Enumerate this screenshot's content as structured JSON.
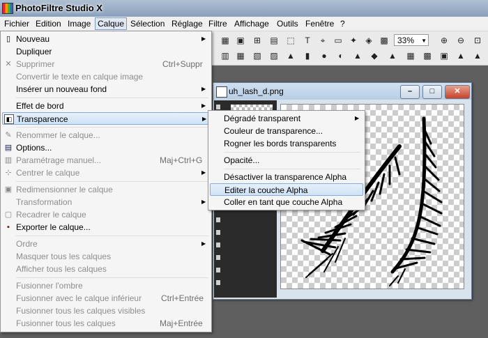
{
  "window": {
    "title": "PhotoFiltre Studio X"
  },
  "menubar": [
    "Fichier",
    "Edition",
    "Image",
    "Calque",
    "Sélection",
    "Réglage",
    "Filtre",
    "Affichage",
    "Outils",
    "Fenêtre",
    "?"
  ],
  "active_menu": "Calque",
  "toolbar": {
    "zoom": "33%"
  },
  "document": {
    "title": "uh_lash_d.png"
  },
  "calque_menu": {
    "items": [
      {
        "label": "Nouveau",
        "icon": "new-page-icon",
        "submenu": true
      },
      {
        "label": "Dupliquer"
      },
      {
        "label": "Supprimer",
        "icon": "delete-x-icon",
        "shortcut": "Ctrl+Suppr",
        "disabled": true
      },
      {
        "label": "Convertir le texte en calque image",
        "disabled": true
      },
      {
        "label": "Insérer un nouveau fond",
        "submenu": true
      },
      {
        "label": "Effet de bord",
        "submenu": true
      },
      {
        "label": "Transparence",
        "icon": "transparency-icon",
        "submenu": true,
        "highlighted": true
      },
      {
        "label": "Renommer le calque...",
        "icon": "rename-icon",
        "disabled": true
      },
      {
        "label": "Options...",
        "icon": "options-icon"
      },
      {
        "label": "Paramétrage manuel...",
        "icon": "manual-settings-icon",
        "shortcut": "Maj+Ctrl+G",
        "disabled": true
      },
      {
        "label": "Centrer le calque",
        "icon": "center-icon",
        "submenu": true,
        "disabled": true
      },
      {
        "label": "Redimensionner le calque",
        "icon": "resize-icon",
        "disabled": true
      },
      {
        "label": "Transformation",
        "submenu": true
      },
      {
        "label": "Recadrer le calque",
        "icon": "crop-icon",
        "disabled": true
      },
      {
        "label": "Exporter le calque...",
        "icon": "save-icon"
      },
      {
        "label": "Ordre",
        "submenu": true,
        "disabled": true
      },
      {
        "label": "Masquer tous les calques",
        "disabled": true
      },
      {
        "label": "Afficher tous les calques",
        "disabled": true
      },
      {
        "label": "Fusionner l'ombre",
        "disabled": true
      },
      {
        "label": "Fusionner avec le calque inférieur",
        "shortcut": "Ctrl+Entrée",
        "disabled": true
      },
      {
        "label": "Fusionner tous les calques visibles",
        "disabled": true
      },
      {
        "label": "Fusionner tous les calques",
        "shortcut": "Maj+Entrée",
        "disabled": true
      }
    ]
  },
  "transparence_menu": {
    "items": [
      {
        "label": "Dégradé transparent",
        "submenu": true
      },
      {
        "label": "Couleur de transparence..."
      },
      {
        "label": "Rogner les bords transparents"
      },
      {
        "label": "Opacité..."
      },
      {
        "label": "Désactiver la transparence Alpha"
      },
      {
        "label": "Editer la couche Alpha",
        "highlighted": true
      },
      {
        "label": "Coller en tant que couche Alpha"
      }
    ]
  }
}
